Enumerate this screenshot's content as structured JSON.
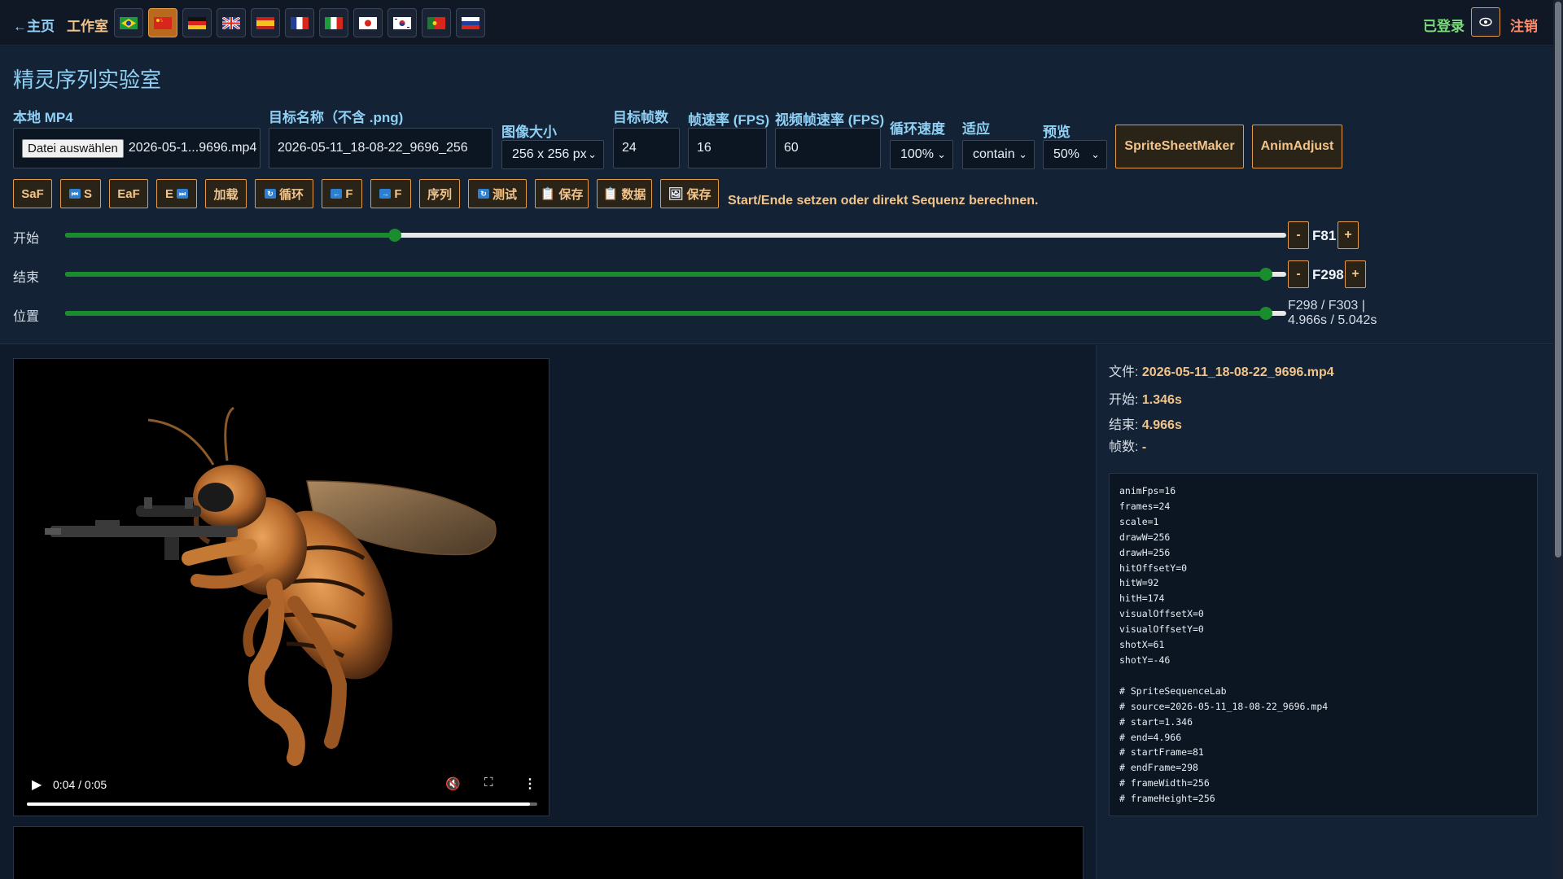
{
  "nav": {
    "home": "←主页",
    "studio": "工作室",
    "flags": [
      "brazil-flag",
      "china-flag",
      "germany-flag",
      "uk-flag",
      "spain-flag",
      "france-flag",
      "italy-flag",
      "japan-flag",
      "korea-flag",
      "portugal-flag",
      "russia-flag"
    ],
    "active_flag": "china-flag",
    "login_status": "已登录",
    "eye_icon": "eye-icon",
    "logout": "注销"
  },
  "page": {
    "title": "精灵序列实验室"
  },
  "form": {
    "local_mp4_label": "本地 MP4",
    "file_button": "Datei auswählen",
    "file_name": "2026-05-1...9696.mp4",
    "target_name_label": "目标名称（不含 .png)",
    "target_name_value": "2026-05-11_18-08-22_9696_256",
    "image_size_label": "图像大小",
    "image_size_value": "256 x 256 px",
    "target_frames_label": "目标帧数",
    "target_frames_value": "24",
    "fps_label": "帧速率 (FPS)",
    "fps_value": "16",
    "video_fps_label": "视频帧速率 (FPS)",
    "video_fps_value": "60",
    "loop_speed_label": "循环速度",
    "loop_speed_value": "100%",
    "fit_label": "适应",
    "fit_value": "contain",
    "preview_label": "预览",
    "preview_value": "50%",
    "sprite_sheet_maker": "SpriteSheetMaker",
    "anim_adjust": "AnimAdjust"
  },
  "toolbar": {
    "saf": "SaF",
    "s": "S",
    "eaf": "EaF",
    "e": "E",
    "load": "加载",
    "loop": "循环",
    "prev_f": "F",
    "next_f": "F",
    "sequence": "序列",
    "test": "测试",
    "save1": "保存",
    "data": "数据",
    "save2": "保存",
    "hint": "Start/Ende setzen oder direkt Sequenz berechnen."
  },
  "sliders": {
    "start_label": "开始",
    "start_frame": "F81",
    "start_fraction": 0.27,
    "end_label": "结束",
    "end_frame": "F298",
    "end_fraction": 0.983,
    "position_label": "位置",
    "position_fraction": 0.983,
    "position_readout_line1": "F298 / F303 |",
    "position_readout_line2": "4.966s / 5.042s",
    "minus": "-",
    "plus": "+"
  },
  "video": {
    "time": "0:04 / 0:05",
    "progress_fraction": 0.985
  },
  "info": {
    "file_label": "文件:",
    "file_value": "2026-05-11_18-08-22_9696.mp4",
    "start_label": "开始:",
    "start_value": "1.346s",
    "end_label": "结束:",
    "end_value": "4.966s",
    "frames_label": "帧数:",
    "frames_value": "-"
  },
  "code": "animFps=16\nframes=24\nscale=1\ndrawW=256\ndrawH=256\nhitOffsetY=0\nhitW=92\nhitH=174\nvisualOffsetX=0\nvisualOffsetY=0\nshotX=61\nshotY=-46\n\n# SpriteSequenceLab\n# source=2026-05-11_18-08-22_9696.mp4\n# start=1.346\n# end=4.966\n# startFrame=81\n# endFrame=298\n# frameWidth=256\n# frameHeight=256",
  "colors": {
    "accent": "#e89b47",
    "label_blue": "#8fd0f5",
    "slider_green": "#1b8c2e",
    "background": "#0f1a2a"
  }
}
